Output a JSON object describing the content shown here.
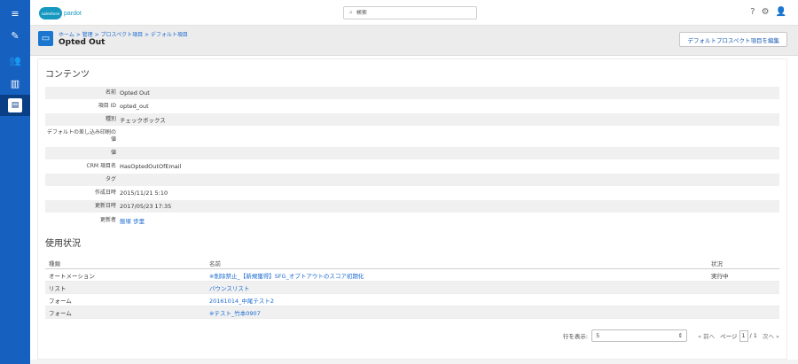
{
  "sidebar": {
    "items": [
      {
        "name": "menu",
        "icon": "≡"
      },
      {
        "name": "marketing",
        "icon": "✎"
      },
      {
        "name": "prospects",
        "icon": "👥"
      },
      {
        "name": "reports",
        "icon": "▥"
      },
      {
        "name": "admin",
        "icon": "▤"
      }
    ]
  },
  "topbar": {
    "logo_cloud": "salesforce",
    "logo_text": "pardot",
    "search_placeholder": "検索",
    "help_icon": "?",
    "settings_icon": "⚙",
    "user_icon": "👤"
  },
  "header": {
    "breadcrumb": "ホーム > 管理 > プロスペクト項目 > デフォルト項目",
    "title": "Opted Out",
    "edit_button": "デフォルトプロスペクト項目を編集"
  },
  "contents": {
    "section_title": "コンテンツ",
    "rows": [
      {
        "label": "名前",
        "value": "Opted Out"
      },
      {
        "label": "項目 ID",
        "value": "opted_out"
      },
      {
        "label": "種別",
        "value": "チェックボックス"
      },
      {
        "label": "デフォルトの差し込み印刷の値",
        "value": ""
      },
      {
        "label": "値",
        "value": ""
      },
      {
        "label": "CRM 項目名",
        "value": "HasOptedOutOfEmail"
      },
      {
        "label": "タグ",
        "value": ""
      },
      {
        "label": "作成日時",
        "value": "2015/11/21 5:10"
      },
      {
        "label": "更新日時",
        "value": "2017/05/23 17:35"
      },
      {
        "label": "更新者",
        "value": "飯塚 歩里"
      }
    ]
  },
  "usage": {
    "section_title": "使用状況",
    "columns": [
      "種類",
      "名前",
      "状況"
    ],
    "rows": [
      {
        "type": "オートメーション",
        "name": "※削除禁止_【新規獲得】SFG_オプトアウトのスコア初期化",
        "status": "実行中"
      },
      {
        "type": "リスト",
        "name": "バウンスリスト",
        "status": ""
      },
      {
        "type": "フォーム",
        "name": "20161014_中尾テスト2",
        "status": ""
      },
      {
        "type": "フォーム",
        "name": "※テスト_竹本0907",
        "status": ""
      }
    ]
  },
  "pager": {
    "rows_label": "行を表示:",
    "rows_value": "5",
    "prev": "« 前へ",
    "page_label": "ページ",
    "page_value": "1",
    "page_total": "/ 1",
    "next": "次へ »"
  }
}
